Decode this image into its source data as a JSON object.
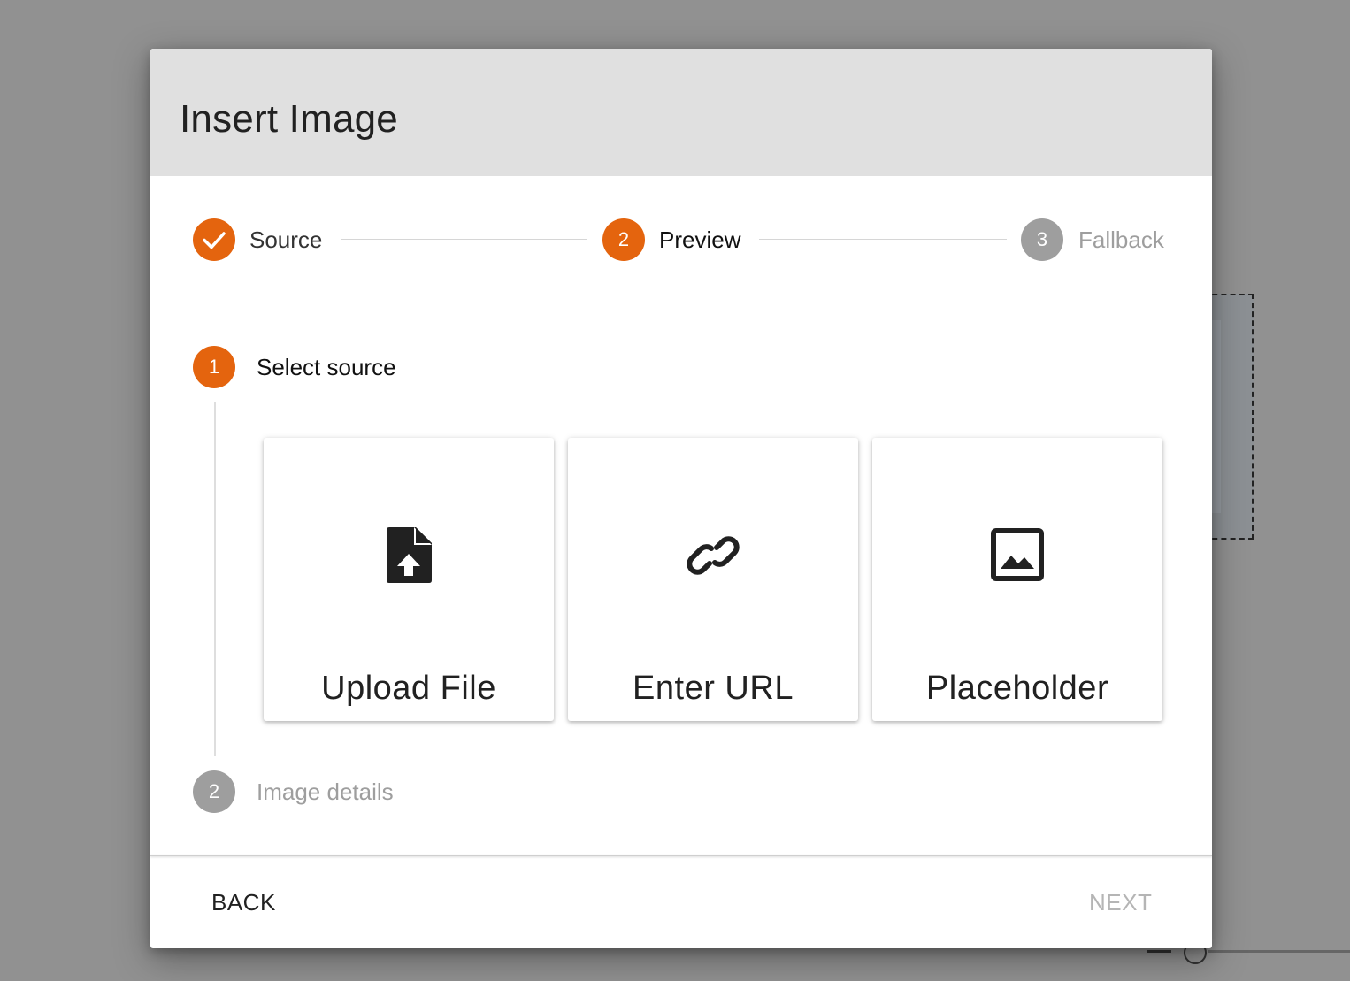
{
  "dialog": {
    "title": "Insert Image"
  },
  "stepper": {
    "steps": [
      {
        "label": "Source",
        "state": "completed",
        "icon": "check-icon"
      },
      {
        "label": "Preview",
        "number": "2",
        "state": "active"
      },
      {
        "label": "Fallback",
        "number": "3",
        "state": "inactive"
      }
    ]
  },
  "source_steps": {
    "items": [
      {
        "number": "1",
        "label": "Select source",
        "state": "active"
      },
      {
        "number": "2",
        "label": "Image details",
        "state": "inactive"
      }
    ]
  },
  "source_options": [
    {
      "label": "Upload File",
      "icon": "upload-file-icon"
    },
    {
      "label": "Enter URL",
      "icon": "link-icon"
    },
    {
      "label": "Placeholder",
      "icon": "image-icon"
    }
  ],
  "footer": {
    "back_label": "BACK",
    "next_label": "NEXT",
    "next_disabled": true
  },
  "colors": {
    "accent": "#e4640e",
    "inactive": "#9e9e9e",
    "overlay": "#919191",
    "header": "#e0e0e0"
  }
}
